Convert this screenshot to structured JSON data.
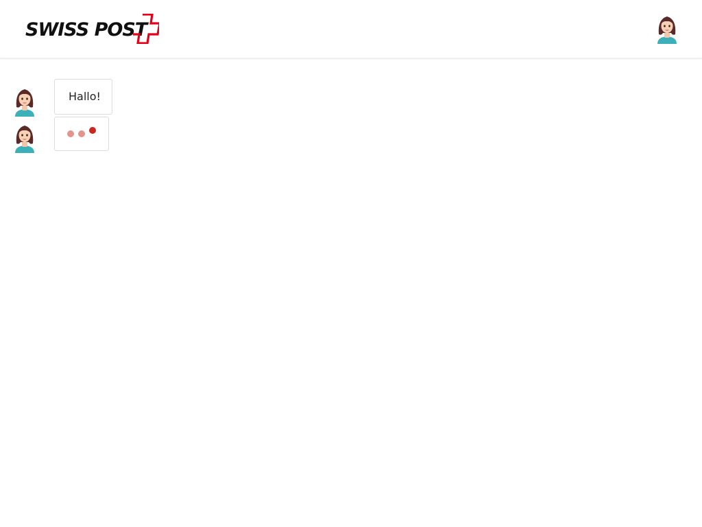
{
  "header": {
    "logo_text": "SWISS POST",
    "logo_cross_color": "#e2001a",
    "user_avatar_icon": "woman-avatar-icon"
  },
  "chat": {
    "messages": [
      {
        "sender": "bot",
        "avatar_icon": "woman-avatar-icon",
        "text": "Hallo!"
      },
      {
        "sender": "bot",
        "avatar_icon": "woman-avatar-icon",
        "typing_indicator": true,
        "dot_colors": [
          "#e2958d",
          "#e2958d",
          "#c8281e"
        ]
      }
    ]
  },
  "colors": {
    "brand_red": "#e2001a",
    "avatar_hair": "#5a2a28",
    "avatar_shirt": "#3bb0b8",
    "bubble_border": "#dcdcdc"
  }
}
